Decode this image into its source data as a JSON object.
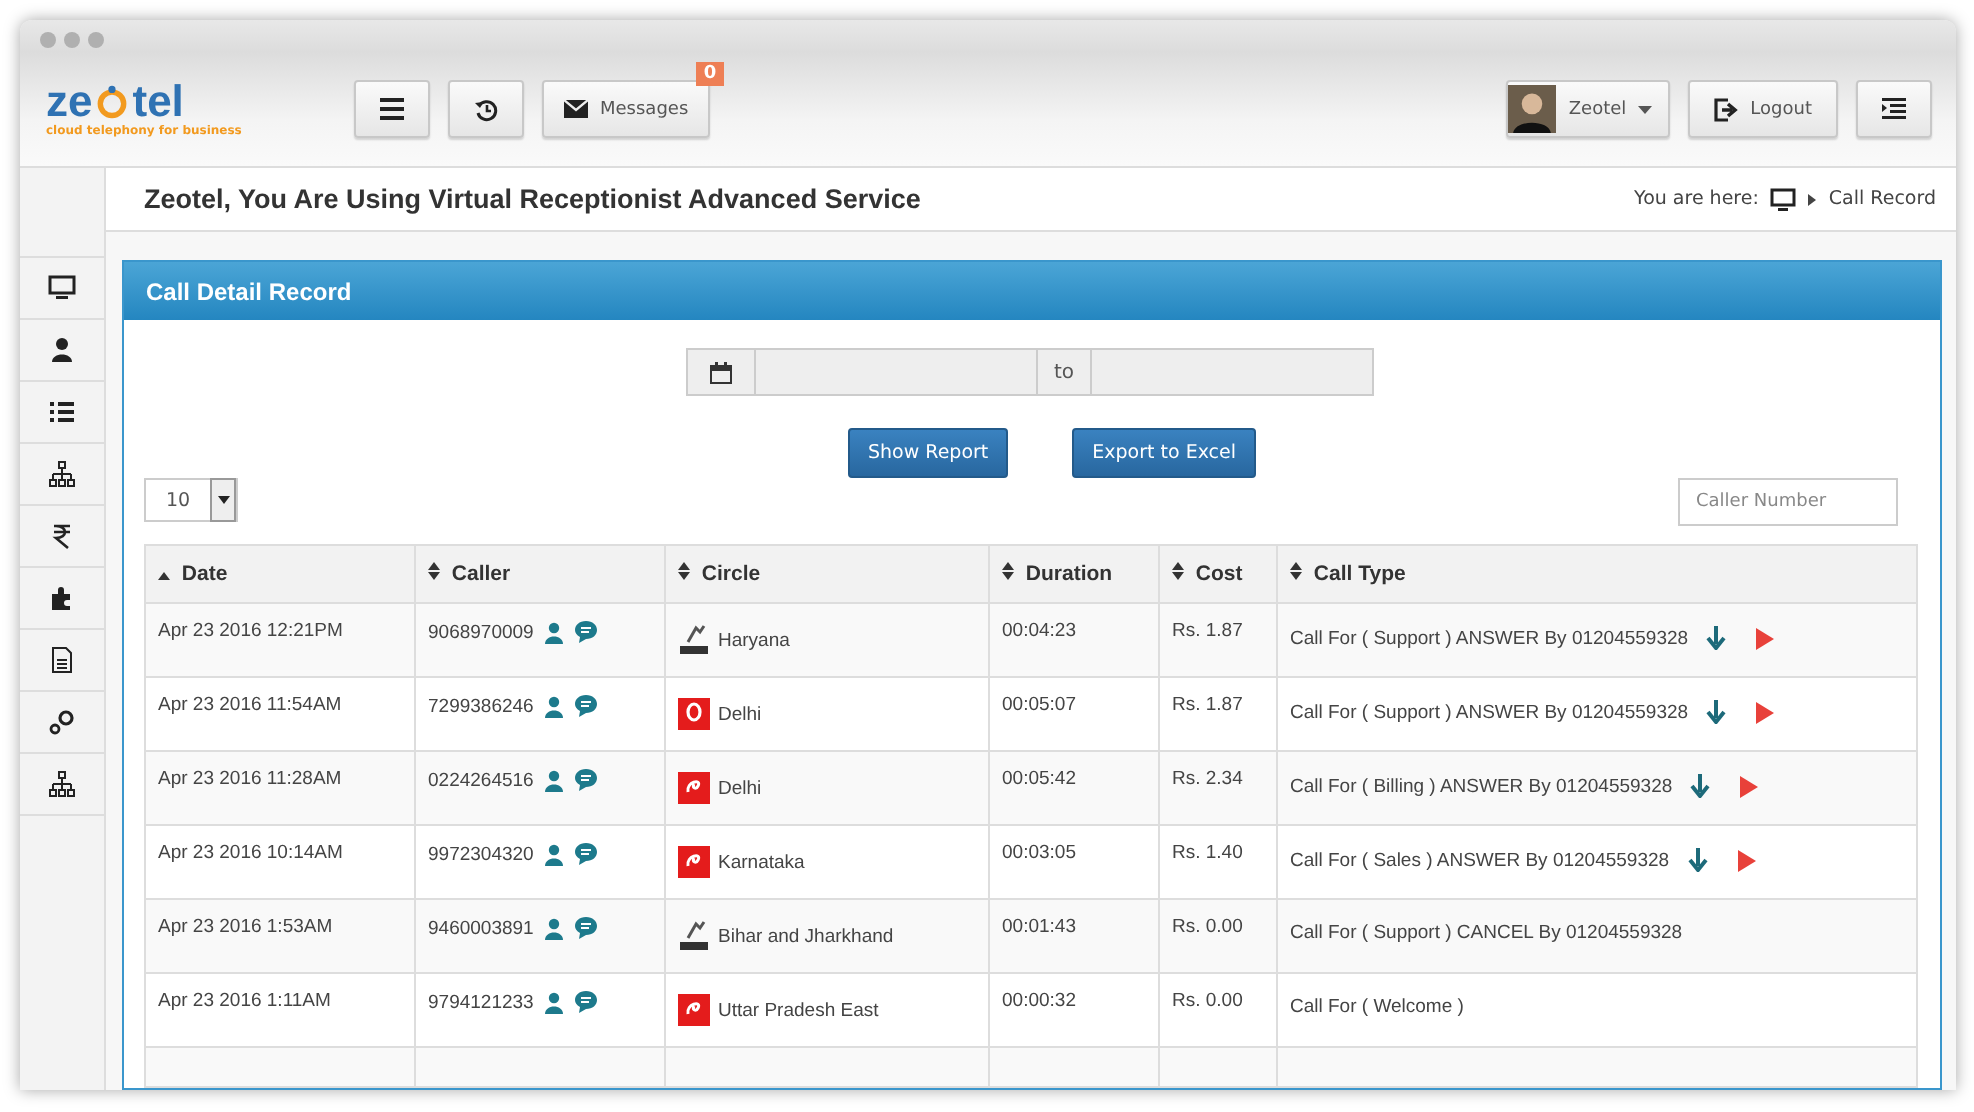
{
  "logo": {
    "left": "ze",
    "right": "tel",
    "tagline": "cloud telephony for business"
  },
  "toolbar": {
    "messages_label": "Messages",
    "messages_count": "0",
    "user": "Zeotel",
    "logout": "Logout"
  },
  "page": {
    "title": "Zeotel, You Are Using Virtual Receptionist Advanced Service",
    "breadcrumb_prefix": "You are here:",
    "breadcrumb_current": "Call Record"
  },
  "panel": {
    "title": "Call Detail Record",
    "range_separator": "to",
    "show_report": "Show Report",
    "export": "Export to Excel",
    "page_size": "10",
    "search_placeholder": "Caller Number"
  },
  "table": {
    "columns": [
      {
        "label": "Date",
        "sorted": true
      },
      {
        "label": "Caller",
        "sorted": false
      },
      {
        "label": "Circle",
        "sorted": false
      },
      {
        "label": "Duration",
        "sorted": false
      },
      {
        "label": "Cost",
        "sorted": false
      },
      {
        "label": "Call Type",
        "sorted": false
      }
    ],
    "rows": [
      {
        "date": "Apr 23 2016 12:21PM",
        "caller": "9068970009",
        "kind": "bsnl",
        "circle": "Haryana",
        "duration": "00:04:23",
        "cost": "Rs. 1.87",
        "call_type": "Call For ( Support ) ANSWER By 01204559328",
        "recording": true
      },
      {
        "date": "Apr 23 2016 11:54AM",
        "caller": "7299386246",
        "kind": "vodafone",
        "circle": "Delhi",
        "duration": "00:05:07",
        "cost": "Rs. 1.87",
        "call_type": "Call For ( Support ) ANSWER By 01204559328",
        "recording": true
      },
      {
        "date": "Apr 23 2016 11:28AM",
        "caller": "0224264516",
        "kind": "airtel",
        "circle": "Delhi",
        "duration": "00:05:42",
        "cost": "Rs. 2.34",
        "call_type": "Call For ( Billing ) ANSWER By 01204559328",
        "recording": true
      },
      {
        "date": "Apr 23 2016 10:14AM",
        "caller": "9972304320",
        "kind": "airtel",
        "circle": "Karnataka",
        "duration": "00:03:05",
        "cost": "Rs. 1.40",
        "call_type": "Call For ( Sales ) ANSWER By 01204559328",
        "recording": true
      },
      {
        "date": "Apr 23 2016 1:53AM",
        "caller": "9460003891",
        "kind": "bsnl",
        "circle": "Bihar and Jharkhand",
        "duration": "00:01:43",
        "cost": "Rs. 0.00",
        "call_type": "Call For ( Support ) CANCEL By 01204559328",
        "recording": false
      },
      {
        "date": "Apr 23 2016 1:11AM",
        "caller": "9794121233",
        "kind": "airtel",
        "circle": "Uttar Pradesh East",
        "duration": "00:00:32",
        "cost": "Rs. 0.00",
        "call_type": "Call For ( Welcome )",
        "recording": false
      }
    ]
  }
}
